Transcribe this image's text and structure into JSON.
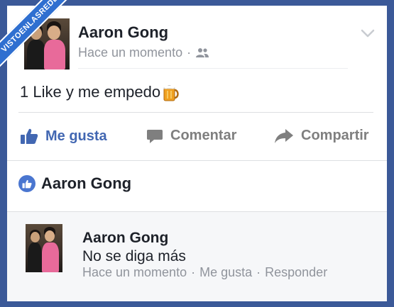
{
  "watermark": {
    "text": "VISTOENLASREDES"
  },
  "post": {
    "author": "Aaron Gong",
    "time": "Hace un momento",
    "separator": "·",
    "audience_icon": "friends-icon",
    "text": "1 Like y me empedo",
    "emoji": "beer-mug-icon"
  },
  "actions": {
    "like": "Me gusta",
    "comment": "Comentar",
    "share": "Compartir"
  },
  "likes": {
    "name": "Aaron Gong"
  },
  "comment": {
    "author": "Aaron Gong",
    "text": "No se diga más",
    "time": "Hace un momento",
    "like": "Me gusta",
    "reply": "Responder",
    "separator": "·"
  },
  "colors": {
    "brand": "#3b5998",
    "like_blue": "#4267b2",
    "meta_gray": "#90949c",
    "text": "#1d2129"
  }
}
